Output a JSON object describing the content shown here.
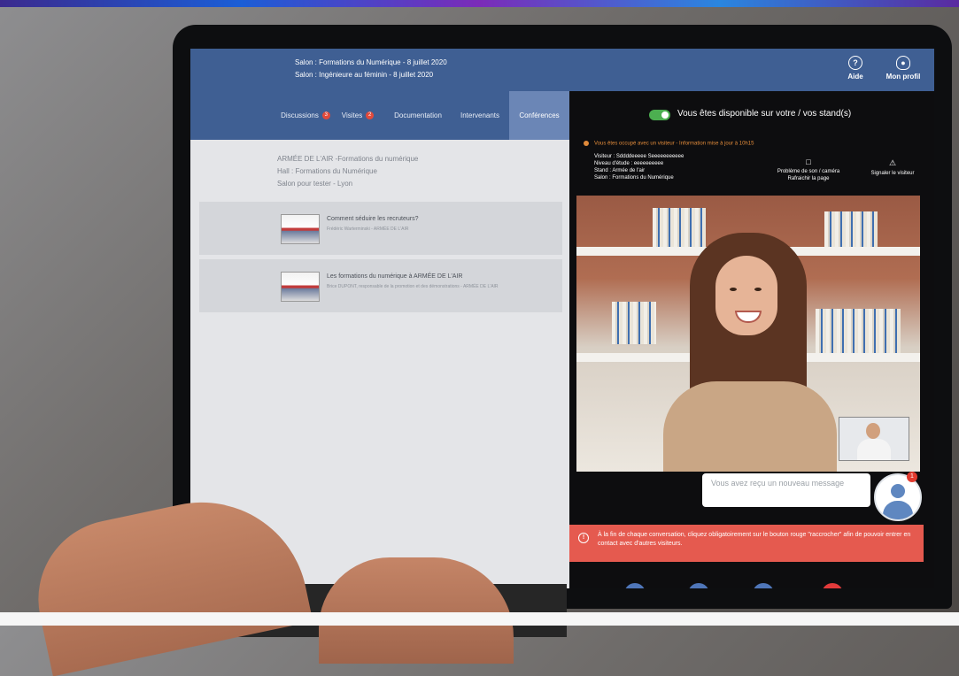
{
  "header": {
    "salon_lines": [
      "Salon : Formations du Numérique - 8 juillet 2020",
      "Salon : Ingénieure au féminin - 8 juillet 2020"
    ],
    "help_label": "Aide",
    "profile_label": "Mon profil"
  },
  "tabs": [
    {
      "label": "Discussions",
      "badge": "3"
    },
    {
      "label": "Visites",
      "badge": "2"
    },
    {
      "label": "Documentation"
    },
    {
      "label": "Intervenants"
    },
    {
      "label": "Conférences"
    }
  ],
  "info": {
    "line1": "ARMÉE DE L'AIR -Formations du numérique",
    "line2": "Hall : Formations du Numérique",
    "line3": "Salon pour tester - Lyon"
  },
  "conferences": [
    {
      "title": "Comment séduire les recruteurs?",
      "subtitle": "Frédéric Warterminski - ARMÉE DE L'AIR"
    },
    {
      "title": "Les formations du numérique à ARMÉE DE L'AIR",
      "subtitle": "Brice DUPONT, responsable de la promotion et des démonstrations - ARMÉE DE L'AIR"
    }
  ],
  "availability": {
    "text": "Vous êtes disponible sur votre / vos stand(s)",
    "busy": "Vous êtes occupé avec un visiteur - Information mise à jour à 10h15"
  },
  "visitor": {
    "line1": "Visiteur : Sddddeeeee Seeeeeeeeeee",
    "line2": "Niveau d'étude : eeeeeeeeee",
    "line3": "Stand : Armée de l'air",
    "line4": "Salon : Formations du Numérique"
  },
  "actions": {
    "issue_line1": "Problème de son / caméra",
    "issue_line2": "Rafraichir la page",
    "report": "Signaler le visiteur"
  },
  "message": {
    "text": "Vous avez reçu un nouveau message",
    "badge": "1"
  },
  "alert": {
    "text": "À la fin de chaque conversation, cliquez obligatoirement sur le bouton rouge \"raccrocher\" afin de pouvoir entrer en contact avec d'autres visiteurs."
  },
  "colors": {
    "header_blue": "#3f5f93",
    "active_tab": "#6b86b6",
    "alert_red": "#e55a4f",
    "toggle_green": "#4caf50",
    "control_blue": "#4f76b9",
    "hangup_red": "#e23b3b"
  },
  "icons": {
    "help": "question-circle-icon",
    "profile": "person-icon",
    "camera": "camera-icon",
    "warning": "warning-icon",
    "mic": "microphone-icon",
    "video": "video-camera-icon",
    "chat": "chat-icon",
    "hangup": "phone-hangup-icon"
  }
}
